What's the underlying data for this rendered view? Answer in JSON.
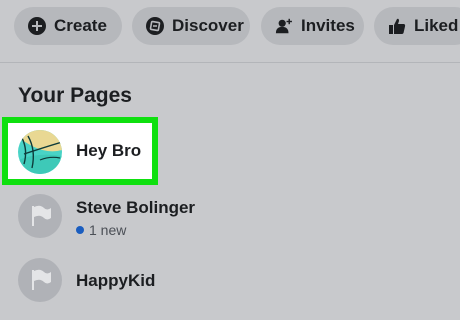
{
  "topbar": {
    "chips": [
      {
        "label": "Create",
        "icon": "plus-circle-icon"
      },
      {
        "label": "Discover",
        "icon": "compass-icon"
      },
      {
        "label": "Invites",
        "icon": "add-person-icon"
      },
      {
        "label": "Liked",
        "icon": "thumbs-up-icon"
      }
    ]
  },
  "section": {
    "title": "Your Pages"
  },
  "pages": [
    {
      "name": "Hey Bro",
      "avatar": "custom-drawing-avatar"
    },
    {
      "name": "Steve Bolinger",
      "badge": "1 new",
      "avatar": "flag-icon"
    },
    {
      "name": "HappyKid",
      "avatar": "flag-icon"
    }
  ],
  "colors": {
    "highlight": "#0fe00f",
    "new_dot": "#1a5dbf",
    "background": "#c8c9cc"
  }
}
